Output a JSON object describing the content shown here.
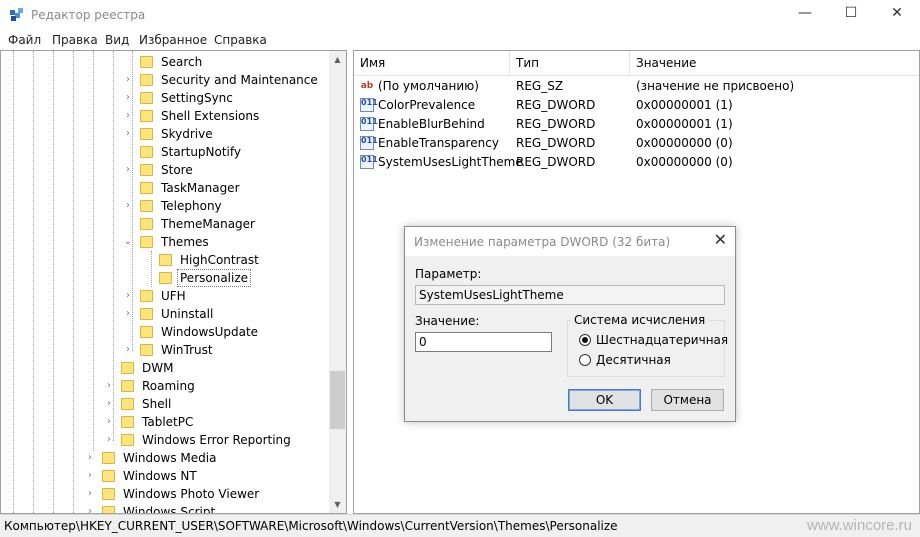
{
  "window": {
    "title": "Редактор реестра",
    "minimize_glyph": "—",
    "maximize_glyph": "☐",
    "close_glyph": "✕"
  },
  "menu": [
    "Файл",
    "Правка",
    "Вид",
    "Избранное",
    "Справка"
  ],
  "tree": {
    "items": [
      {
        "label": "Search",
        "expander": ""
      },
      {
        "label": "Security and Maintenance",
        "expander": "›"
      },
      {
        "label": "SettingSync",
        "expander": "›"
      },
      {
        "label": "Shell Extensions",
        "expander": "›"
      },
      {
        "label": "Skydrive",
        "expander": "›"
      },
      {
        "label": "StartupNotify",
        "expander": ""
      },
      {
        "label": "Store",
        "expander": "›"
      },
      {
        "label": "TaskManager",
        "expander": ""
      },
      {
        "label": "Telephony",
        "expander": "›"
      },
      {
        "label": "ThemeManager",
        "expander": ""
      },
      {
        "label": "Themes",
        "expander": "⌄"
      },
      {
        "label": "HighContrast",
        "expander": ""
      },
      {
        "label": "Personalize",
        "expander": ""
      },
      {
        "label": "UFH",
        "expander": "›"
      },
      {
        "label": "Uninstall",
        "expander": "›"
      },
      {
        "label": "WindowsUpdate",
        "expander": ""
      },
      {
        "label": "WinTrust",
        "expander": "›"
      },
      {
        "label": "DWM",
        "expander": ""
      },
      {
        "label": "Roaming",
        "expander": "›"
      },
      {
        "label": "Shell",
        "expander": "›"
      },
      {
        "label": "TabletPC",
        "expander": "›"
      },
      {
        "label": "Windows Error Reporting",
        "expander": "›"
      },
      {
        "label": "Windows Media",
        "expander": "›"
      },
      {
        "label": "Windows NT",
        "expander": "›"
      },
      {
        "label": "Windows Photo Viewer",
        "expander": "›"
      },
      {
        "label": "Windows Script",
        "expander": "›"
      }
    ]
  },
  "values": {
    "headers": {
      "name": "Имя",
      "type": "Тип",
      "data": "Значение"
    },
    "rows": [
      {
        "icon": "string-value-icon",
        "icon_glyph": "ab",
        "name": "(По умолчанию)",
        "type": "REG_SZ",
        "data": "(значение не присвоено)"
      },
      {
        "icon": "binary-value-icon",
        "icon_glyph": "011",
        "name": "ColorPrevalence",
        "type": "REG_DWORD",
        "data": "0x00000001 (1)"
      },
      {
        "icon": "binary-value-icon",
        "icon_glyph": "011",
        "name": "EnableBlurBehind",
        "type": "REG_DWORD",
        "data": "0x00000001 (1)"
      },
      {
        "icon": "binary-value-icon",
        "icon_glyph": "011",
        "name": "EnableTransparency",
        "type": "REG_DWORD",
        "data": "0x00000000 (0)"
      },
      {
        "icon": "binary-value-icon",
        "icon_glyph": "011",
        "name": "SystemUsesLightTheme",
        "type": "REG_DWORD",
        "data": "0x00000000 (0)"
      }
    ]
  },
  "dialog": {
    "title": "Изменение параметра DWORD (32 бита)",
    "close_glyph": "✕",
    "param_label": "Параметр:",
    "param_value": "SystemUsesLightTheme",
    "value_label": "Значение:",
    "value_input": "0",
    "base_group_label": "Система исчисления",
    "base_hex_label": "Шестнадцатеричная",
    "base_dec_label": "Десятичная",
    "base_selected": "hex",
    "ok_label": "OK",
    "cancel_label": "Отмена"
  },
  "status": {
    "path": "Компьютер\\HKEY_CURRENT_USER\\SOFTWARE\\Microsoft\\Windows\\CurrentVersion\\Themes\\Personalize",
    "watermark": "www.wincore.ru"
  }
}
